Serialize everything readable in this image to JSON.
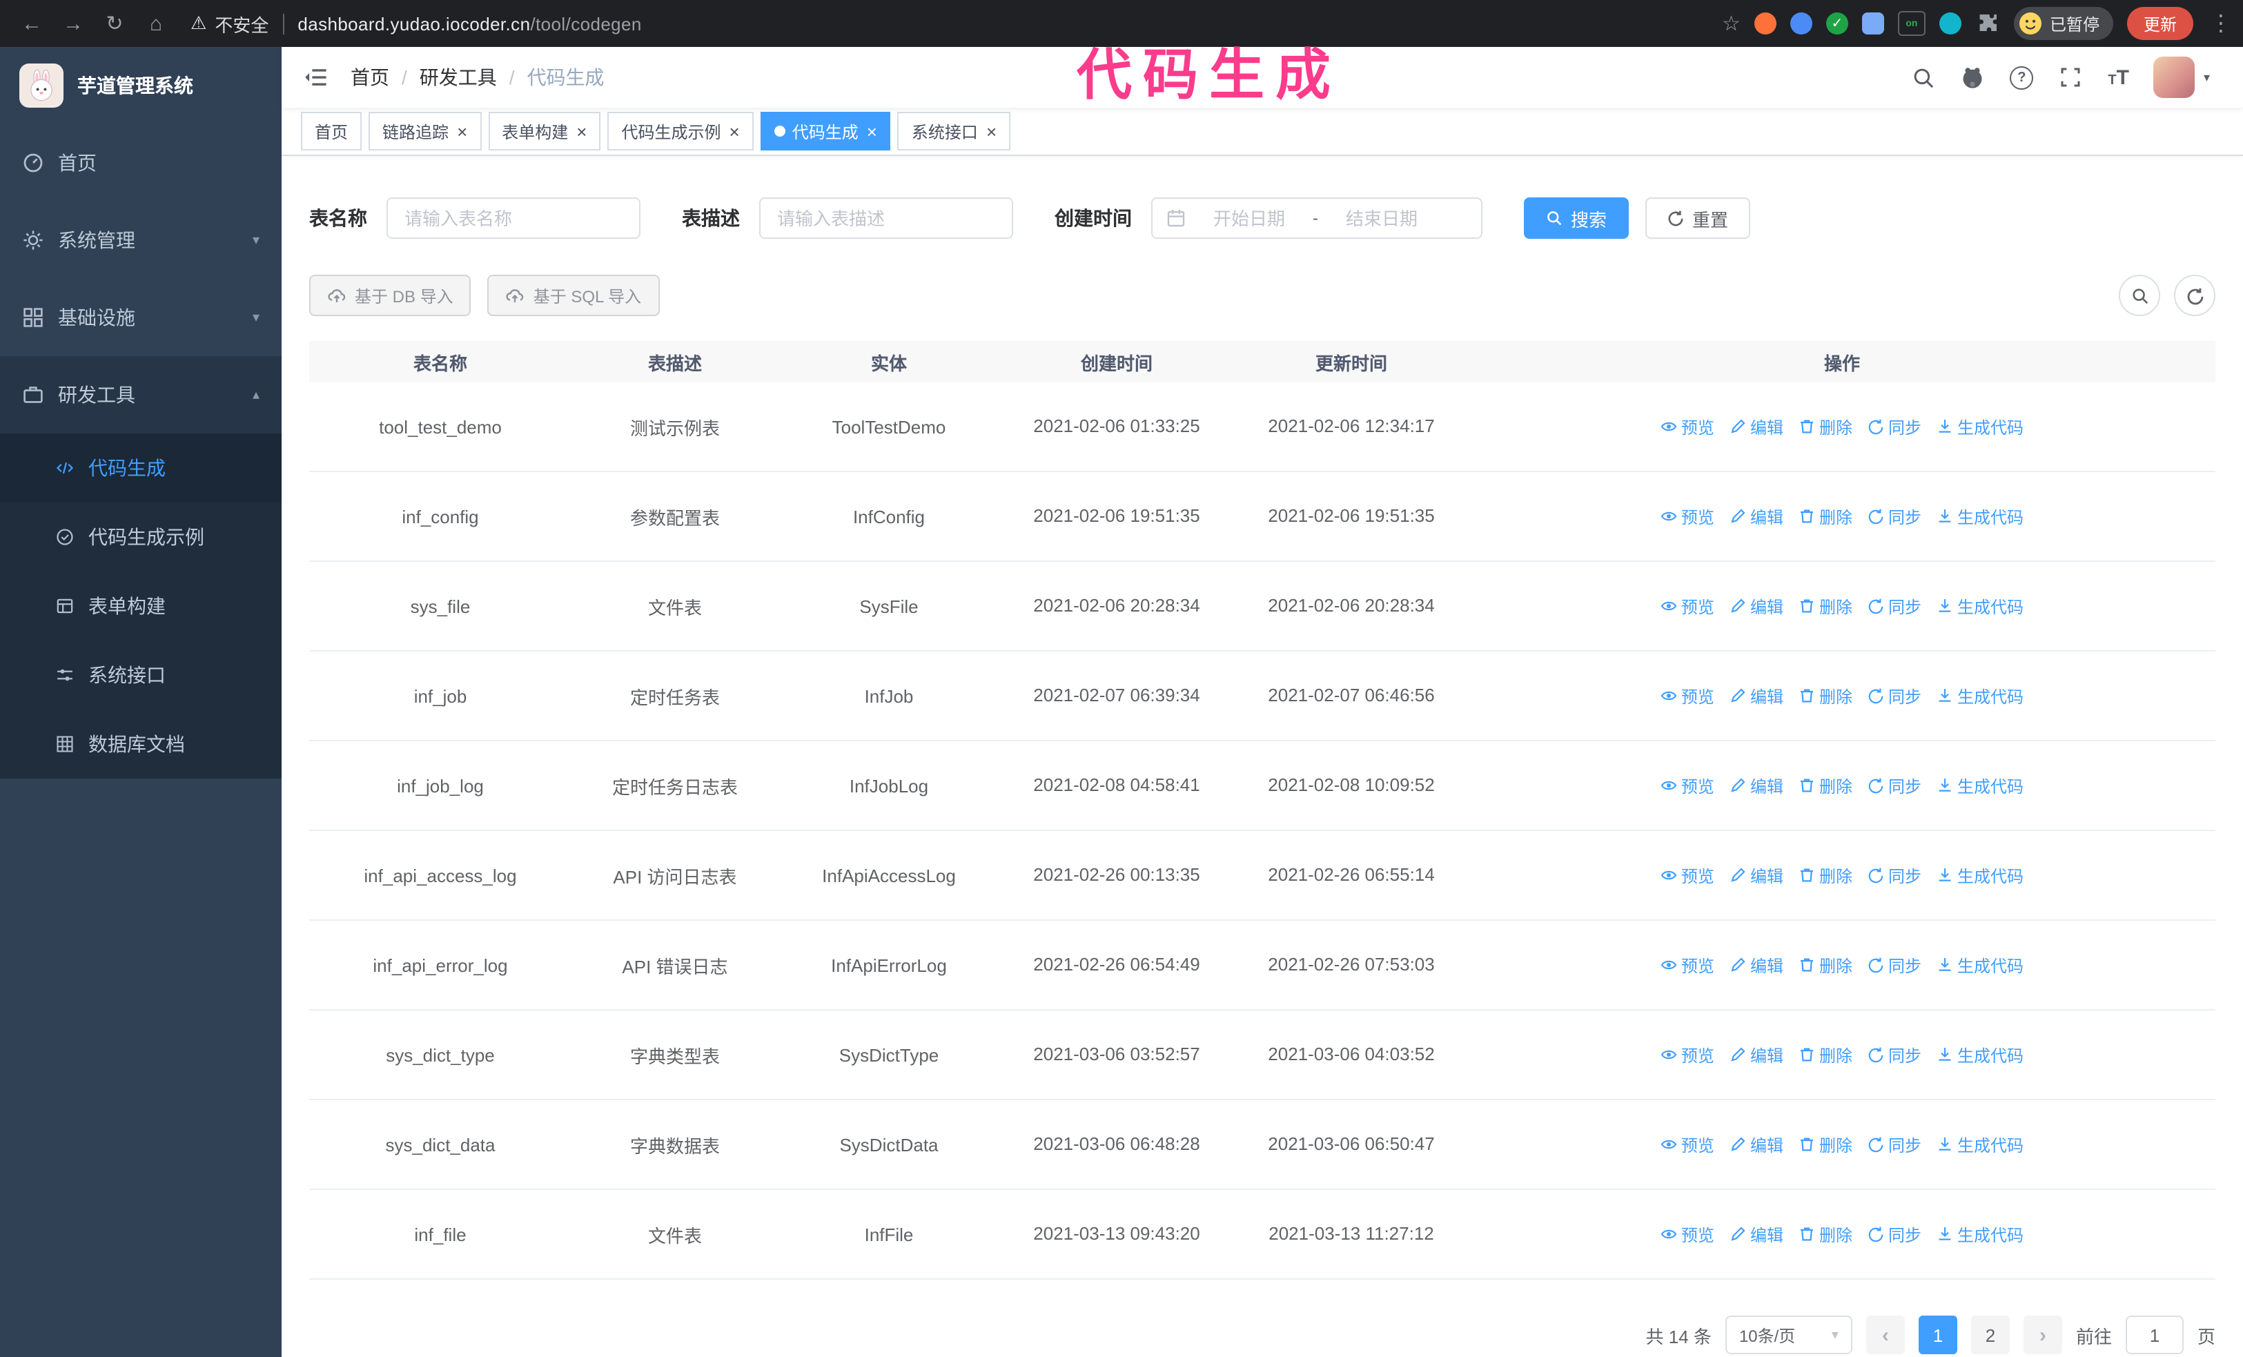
{
  "colors": {
    "primary": "#409eff",
    "overlay_title": "#fb3b8c",
    "update_button": "#dd5144",
    "sidebar_bg": "#304156",
    "submenu_bg": "#1f2d3d"
  },
  "icons": {
    "close": "×",
    "caret_down": "▾",
    "chevron_down": "▾",
    "chevron_up": "▴",
    "back": "←",
    "forward": "→",
    "reload": "↻",
    "home": "⌂",
    "warning": "⚠",
    "star": "☆",
    "more": "⋮",
    "question": "?",
    "slash": "/",
    "chevron_left": "‹",
    "chevron_right": "›",
    "check": "✓",
    "font_large": "T",
    "font_small": "T",
    "ext_on": "on"
  },
  "browser": {
    "security_label": "不安全",
    "url_host": "dashboard.yudao.iocoder.cn",
    "url_path": "/tool/codegen",
    "profile_status": "已暂停",
    "update_label": "更新"
  },
  "overlay_title": "代码生成",
  "sidebar": {
    "app_title": "芋道管理系统",
    "items": [
      {
        "label": "首页"
      },
      {
        "label": "系统管理"
      },
      {
        "label": "基础设施"
      },
      {
        "label": "研发工具"
      }
    ],
    "submenu": [
      {
        "label": "代码生成",
        "active": true
      },
      {
        "label": "代码生成示例"
      },
      {
        "label": "表单构建"
      },
      {
        "label": "系统接口"
      },
      {
        "label": "数据库文档"
      }
    ]
  },
  "header": {
    "breadcrumbs": [
      "首页",
      "研发工具",
      "代码生成"
    ]
  },
  "tabs": [
    {
      "label": "首页",
      "closable": false,
      "active": false
    },
    {
      "label": "链路追踪",
      "closable": true,
      "active": false
    },
    {
      "label": "表单构建",
      "closable": true,
      "active": false
    },
    {
      "label": "代码生成示例",
      "closable": true,
      "active": false
    },
    {
      "label": "代码生成",
      "closable": true,
      "active": true
    },
    {
      "label": "系统接口",
      "closable": true,
      "active": false
    }
  ],
  "filters": {
    "table_name_label": "表名称",
    "table_name_placeholder": "请输入表名称",
    "table_desc_label": "表描述",
    "table_desc_placeholder": "请输入表描述",
    "create_time_label": "创建时间",
    "date_start_placeholder": "开始日期",
    "date_separator": "-",
    "date_end_placeholder": "结束日期",
    "search_button": "搜索",
    "reset_button": "重置"
  },
  "toolbar": {
    "import_db_button": "基于 DB 导入",
    "import_sql_button": "基于 SQL 导入"
  },
  "table": {
    "columns": [
      "表名称",
      "表描述",
      "实体",
      "创建时间",
      "更新时间",
      "操作"
    ],
    "actions": [
      "预览",
      "编辑",
      "删除",
      "同步",
      "生成代码"
    ],
    "rows": [
      {
        "name": "tool_test_demo",
        "desc": "测试示例表",
        "entity": "ToolTestDemo",
        "created": "2021-02-06 01:33:25",
        "updated": "2021-02-06 12:34:17"
      },
      {
        "name": "inf_config",
        "desc": "参数配置表",
        "entity": "InfConfig",
        "created": "2021-02-06 19:51:35",
        "updated": "2021-02-06 19:51:35"
      },
      {
        "name": "sys_file",
        "desc": "文件表",
        "entity": "SysFile",
        "created": "2021-02-06 20:28:34",
        "updated": "2021-02-06 20:28:34"
      },
      {
        "name": "inf_job",
        "desc": "定时任务表",
        "entity": "InfJob",
        "created": "2021-02-07 06:39:34",
        "updated": "2021-02-07 06:46:56"
      },
      {
        "name": "inf_job_log",
        "desc": "定时任务日志表",
        "entity": "InfJobLog",
        "created": "2021-02-08 04:58:41",
        "updated": "2021-02-08 10:09:52"
      },
      {
        "name": "inf_api_access_log",
        "desc": "API 访问日志表",
        "entity": "InfApiAccessLog",
        "created": "2021-02-26 00:13:35",
        "updated": "2021-02-26 06:55:14"
      },
      {
        "name": "inf_api_error_log",
        "desc": "API 错误日志",
        "entity": "InfApiErrorLog",
        "created": "2021-02-26 06:54:49",
        "updated": "2021-02-26 07:53:03"
      },
      {
        "name": "sys_dict_type",
        "desc": "字典类型表",
        "entity": "SysDictType",
        "created": "2021-03-06 03:52:57",
        "updated": "2021-03-06 04:03:52"
      },
      {
        "name": "sys_dict_data",
        "desc": "字典数据表",
        "entity": "SysDictData",
        "created": "2021-03-06 06:48:28",
        "updated": "2021-03-06 06:50:47"
      },
      {
        "name": "inf_file",
        "desc": "文件表",
        "entity": "InfFile",
        "created": "2021-03-13 09:43:20",
        "updated": "2021-03-13 11:27:12"
      }
    ]
  },
  "pagination": {
    "total": "共 14 条",
    "page_size": "10条/页",
    "pages": [
      "1",
      "2"
    ],
    "current": "1",
    "goto_label": "前往",
    "goto_value": "1",
    "page_label": "页"
  }
}
